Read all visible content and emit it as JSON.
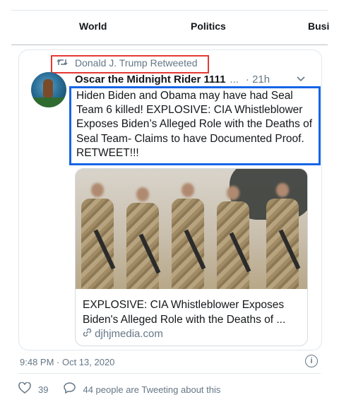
{
  "nav": {
    "tabs": [
      "World",
      "Politics",
      "Busi"
    ]
  },
  "tweet": {
    "retweeted_by": "Donald J. Trump Retweeted",
    "author_name": "Oscar the Midnight Rider 1111",
    "author_ellipsis": "...",
    "time": "· 21h",
    "text": "Hiden Biden and Obama may have had Seal Team 6 killed! EXPLOSIVE: CIA Whistleblower Exposes Biden’s Alleged Role with the Deaths of Seal Team- Claims to have Documented Proof. RETWEET!!!",
    "card": {
      "title": "EXPLOSIVE: CIA Whistleblower Exposes Biden's Alleged Role with the Deaths of ...",
      "domain": "djhjmedia.com"
    },
    "timestamp": "9:48 PM · Oct 13, 2020",
    "likes": "39",
    "tweeting_about": "44 people are Tweeting about this"
  },
  "icons": {
    "retweet": "retweet-icon",
    "chevron": "chevron-down-icon",
    "link": "link-icon",
    "info": "info-icon",
    "heart": "heart-icon",
    "reply": "reply-icon"
  },
  "colors": {
    "highlight_red": "#e53935",
    "highlight_blue": "#1565e6",
    "muted_text": "#657786"
  }
}
